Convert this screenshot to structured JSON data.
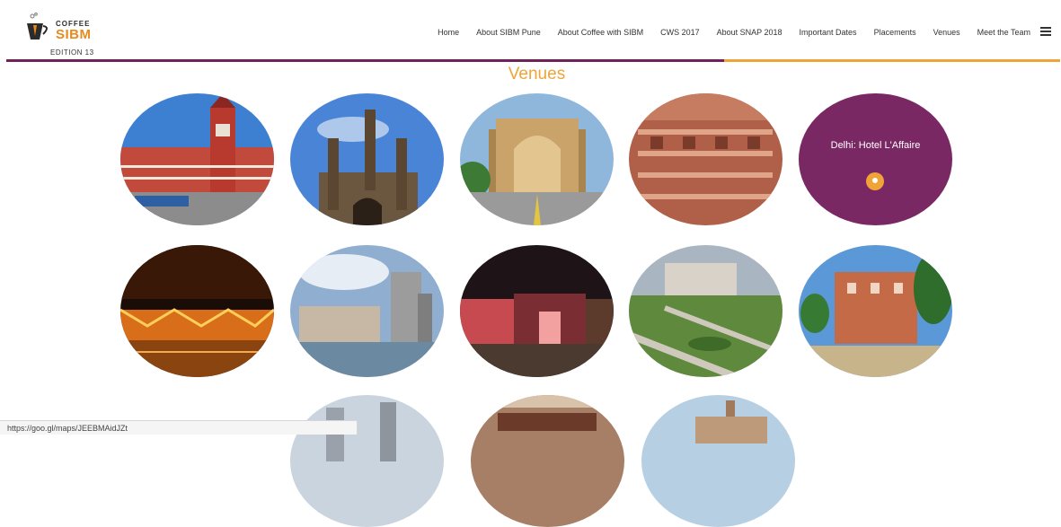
{
  "logo": {
    "line1": "COFFEE",
    "line2": "SIBM",
    "line3": "EDITION 13"
  },
  "nav": {
    "items": [
      "Home",
      "About SIBM Pune",
      "About Coffee with SIBM",
      "CWS 2017",
      "About SNAP 2018",
      "Important Dates",
      "Placements",
      "Venues",
      "Meet the Team"
    ]
  },
  "section": {
    "title": "Venues"
  },
  "hover_venue": {
    "label": "Delhi: Hotel L'Affaire"
  },
  "status": {
    "url": "https://goo.gl/maps/JEEBMAidJZt"
  },
  "colors": {
    "accent_orange": "#f0a438",
    "accent_purple": "#7a2864",
    "bar_purple": "#6e2358"
  }
}
